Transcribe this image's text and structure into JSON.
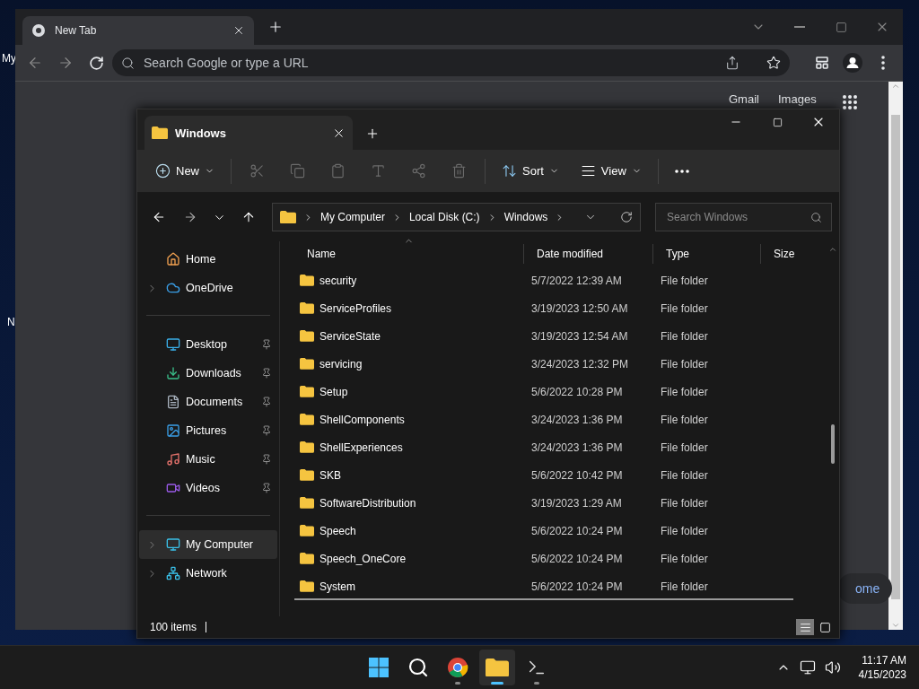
{
  "desktop": {
    "icon_labels": [
      "My",
      "N"
    ]
  },
  "browser": {
    "tab": {
      "title": "New Tab"
    },
    "omnibox": {
      "placeholder": "Search Google or type a URL"
    },
    "links": [
      "Gmail",
      "Images"
    ],
    "customize_button": "ome"
  },
  "explorer": {
    "tab": {
      "title": "Windows"
    },
    "toolbar": {
      "new": "New",
      "sort": "Sort",
      "view": "View"
    },
    "breadcrumb": [
      "My Computer",
      "Local Disk (C:)",
      "Windows"
    ],
    "search": {
      "placeholder": "Search Windows"
    },
    "sidebar": {
      "sections": [
        [
          {
            "label": "Home",
            "expandable": false,
            "pinned": false,
            "selected": false
          },
          {
            "label": "OneDrive",
            "expandable": true,
            "pinned": false,
            "selected": false
          }
        ],
        [
          {
            "label": "Desktop",
            "expandable": false,
            "pinned": true,
            "selected": false
          },
          {
            "label": "Downloads",
            "expandable": false,
            "pinned": true,
            "selected": false
          },
          {
            "label": "Documents",
            "expandable": false,
            "pinned": true,
            "selected": false
          },
          {
            "label": "Pictures",
            "expandable": false,
            "pinned": true,
            "selected": false
          },
          {
            "label": "Music",
            "expandable": false,
            "pinned": true,
            "selected": false
          },
          {
            "label": "Videos",
            "expandable": false,
            "pinned": true,
            "selected": false
          }
        ],
        [
          {
            "label": "My Computer",
            "expandable": true,
            "pinned": false,
            "selected": true
          },
          {
            "label": "Network",
            "expandable": true,
            "pinned": false,
            "selected": false
          }
        ]
      ]
    },
    "columns": [
      "Name",
      "Date modified",
      "Type",
      "Size"
    ],
    "rows": [
      {
        "name": "security",
        "date": "5/7/2022 12:39 AM",
        "type": "File folder"
      },
      {
        "name": "ServiceProfiles",
        "date": "3/19/2023 12:50 AM",
        "type": "File folder"
      },
      {
        "name": "ServiceState",
        "date": "3/19/2023 12:54 AM",
        "type": "File folder"
      },
      {
        "name": "servicing",
        "date": "3/24/2023 12:32 PM",
        "type": "File folder"
      },
      {
        "name": "Setup",
        "date": "5/6/2022 10:28 PM",
        "type": "File folder"
      },
      {
        "name": "ShellComponents",
        "date": "3/24/2023 1:36 PM",
        "type": "File folder"
      },
      {
        "name": "ShellExperiences",
        "date": "3/24/2023 1:36 PM",
        "type": "File folder"
      },
      {
        "name": "SKB",
        "date": "5/6/2022 10:42 PM",
        "type": "File folder"
      },
      {
        "name": "SoftwareDistribution",
        "date": "3/19/2023 1:29 AM",
        "type": "File folder"
      },
      {
        "name": "Speech",
        "date": "5/6/2022 10:24 PM",
        "type": "File folder"
      },
      {
        "name": "Speech_OneCore",
        "date": "5/6/2022 10:24 PM",
        "type": "File folder"
      },
      {
        "name": "System",
        "date": "5/6/2022 10:24 PM",
        "type": "File folder"
      }
    ],
    "status_bar": {
      "count": "100 items",
      "views": [
        {
          "selected": true
        },
        {
          "selected": false
        }
      ]
    }
  },
  "taskbar": {
    "apps": [
      {
        "selected": false
      },
      {
        "selected": false
      },
      {
        "selected": false
      },
      {
        "selected": true
      },
      {
        "selected": false
      }
    ],
    "time": "11:17 AM",
    "date": "4/15/2023"
  }
}
